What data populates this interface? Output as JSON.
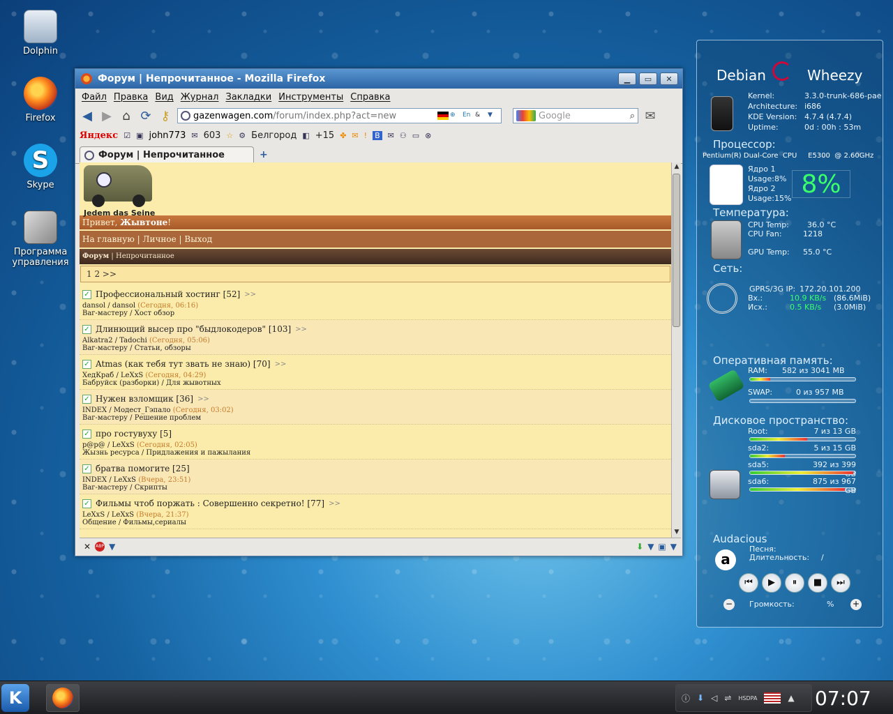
{
  "desktop": {
    "icons": [
      {
        "label": "Dolphin"
      },
      {
        "label": "Firefox"
      },
      {
        "label": "Skype"
      },
      {
        "label": "Программа управления"
      }
    ]
  },
  "firefox": {
    "title": "Форум | Непрочитанное - Mozilla Firefox",
    "window_buttons": [
      "▁",
      "▭",
      "✕"
    ],
    "menu": [
      "Файл",
      "Правка",
      "Вид",
      "Журнал",
      "Закладки",
      "Инструменты",
      "Справка"
    ],
    "url": {
      "domain": "gazenwagen.com",
      "path": "/forum/index.php?act=new"
    },
    "search_placeholder": "Google",
    "yandex_bar": {
      "brand": "Яндекс",
      "user": "john773",
      "mail_count": "603",
      "city": "Белгород",
      "weather": "+15"
    },
    "tab": {
      "label": "Форум | Непрочитанное",
      "new_tab": "+"
    },
    "forum": {
      "slogan": "Jedem das Seine",
      "greeting_prefix": "Привет, ",
      "greeting_user": "Жывтоне",
      "greeting_suffix": "!",
      "nav": "На главную | Личное | Выход",
      "crumb_bold": "Форум",
      "crumb_rest": " | Непрочитанное",
      "pager": "1 2 >>",
      "topics": [
        {
          "title": "Профессиональный хостинг [52]",
          "more": ">>",
          "authors": "dansol / dansol",
          "time": "(Сегодня, 06:16)",
          "category": "Ваг-мастеру / Хост обзор"
        },
        {
          "title": "Длинющий высер про \"быдлокодеров\" [103]",
          "more": ">>",
          "authors": "Alkatra2 / Tadochi",
          "time": "(Сегодня, 05:06)",
          "category": "Ваг-мастеру / Статьи, обзоры"
        },
        {
          "title": "Atmas (как тебя тут звать не знаю) [70]",
          "more": ">>",
          "authors": "ХедКраб / LeXxS",
          "time": "(Сегодня, 04:29)",
          "category": "Бабруйск (разборки) / Для жывотных"
        },
        {
          "title": "Нужен взломщик [36]",
          "more": ">>",
          "authors": "INDEX / Модест_Гэпало",
          "time": "(Сегодня, 03:02)",
          "category": "Ваг-мастеру / Решение проблем"
        },
        {
          "title": "про гостувуху [5]",
          "more": "",
          "authors": "p@p@ / LeXxS",
          "time": "(Сегодня, 02:05)",
          "category": "Жызнь ресурса / Придлажения и пажылания"
        },
        {
          "title": "братва помогите [25]",
          "more": "",
          "authors": "INDEX / LeXxS",
          "time": "(Вчера, 23:51)",
          "category": "Ваг-мастеру / Скрипты"
        },
        {
          "title": "Фильмы чтоб поржать : Совершенно секретно! [77]",
          "more": ">>",
          "authors": "LeXxS / LeXxS",
          "time": "(Вчера, 21:37)",
          "category": "Общение / Фильмы,сериалы"
        }
      ]
    }
  },
  "sysmon": {
    "distro": "Debian",
    "codename": "Wheezy",
    "kernel_label": "Kernel:",
    "kernel": "3.3.0-trunk-686-pae",
    "arch_label": "Architecture:",
    "arch": "i686",
    "kde_label": "KDE Version:",
    "kde": "4.7.4 (4.7.4)",
    "uptime_label": "Uptime:",
    "uptime": "0d : 00h : 53m",
    "cpu_section": "Процессор:",
    "cpu_model": "Pentium(R) Dual-Core  CPU     E5300  @ 2.60GHz",
    "core1": "Ядро 1",
    "core1_usage": "Usage:8%",
    "core2": "Ядро 2",
    "core2_usage": "Usage:15%",
    "cpu_big": "8%",
    "temp_section": "Температура:",
    "cpu_temp_label": "CPU Temp:",
    "cpu_temp": "36.0   °C",
    "cpu_fan_label": "CPU Fan:",
    "cpu_fan": "1218",
    "gpu_temp_label": "GPU Temp:",
    "gpu_temp": "55.0   °C",
    "net_section": "Сеть:",
    "net_ip_label": "GPRS/3G IP:",
    "net_ip": "172.20.101.200",
    "net_in_label": "Вх.:",
    "net_in": "10.9 KB/s",
    "net_in_total": "(86.6MiB)",
    "net_out_label": "Исх.:",
    "net_out": "0.5 KB/s",
    "net_out_total": "(3.0MiB)",
    "ram_section": "Оперативная память:",
    "ram_label": "RAM:",
    "ram": "582 из 3041 MB",
    "ram_fraction": 0.19,
    "swap_label": "SWAP:",
    "swap": "0 из 957 MB",
    "swap_fraction": 0.0,
    "disk_section": "Дисковое пространство:",
    "disks": [
      {
        "name": "Root:",
        "value": "7 из 13 GB",
        "fraction": 0.54
      },
      {
        "name": "sda2:",
        "value": "5 из 15 GB",
        "fraction": 0.33
      },
      {
        "name": "sda5:",
        "value": "392 из 399 GB",
        "fraction": 0.98
      },
      {
        "name": "sda6:",
        "value": "875 из 967 GB",
        "fraction": 0.9
      }
    ],
    "player_section": "Audacious",
    "song_label": "Песня:",
    "duration_label": "Длительность:",
    "duration": "/",
    "volume_label": "Громкость:",
    "volume": "%"
  },
  "taskbar": {
    "clock": "07:07",
    "tray_network": "HSDPA"
  }
}
